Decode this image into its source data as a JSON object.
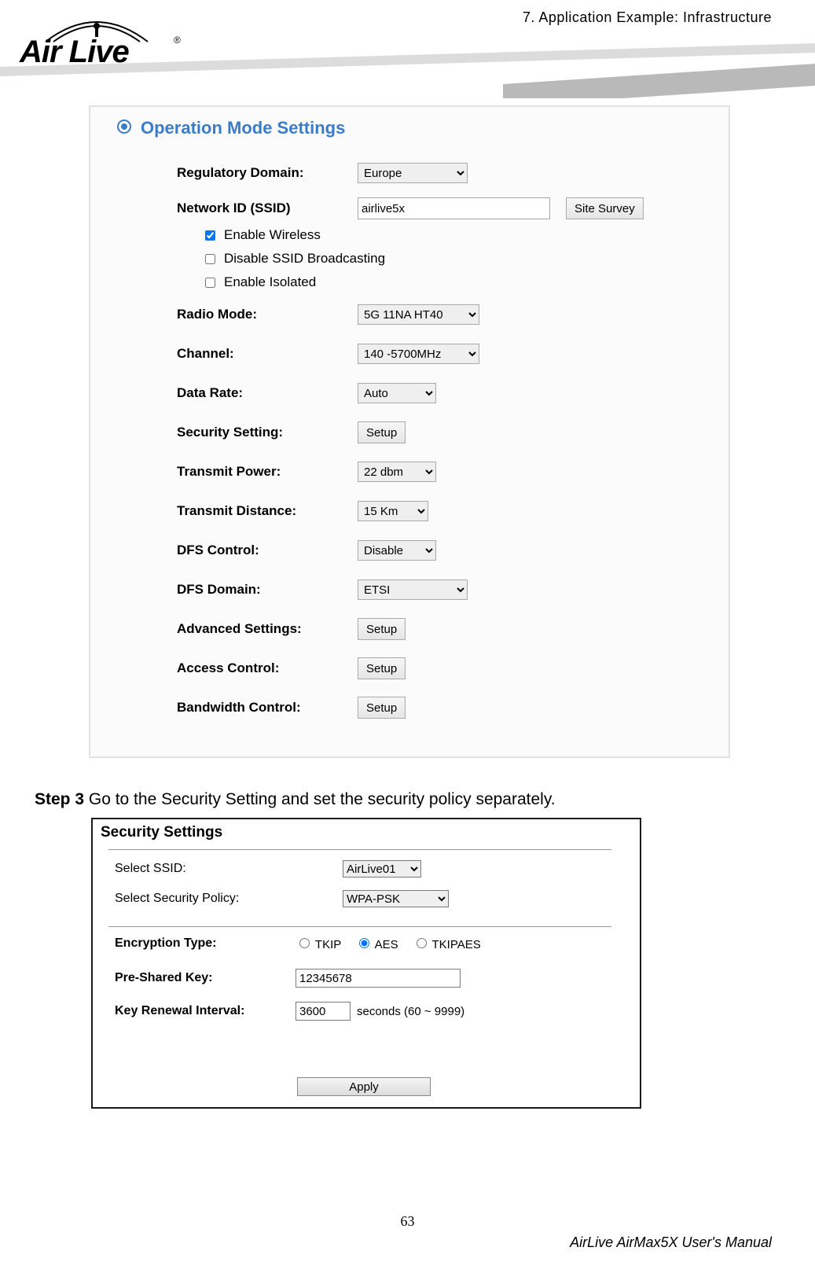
{
  "header": {
    "section": "7. Application Example: Infrastructure",
    "logo_text": "Air Live",
    "logo_tm": "®"
  },
  "panel1": {
    "title": "Operation Mode Settings",
    "rows": {
      "regulatory_label": "Regulatory Domain:",
      "regulatory_value": "Europe",
      "ssid_label": "Network ID (SSID)",
      "ssid_value": "airlive5x",
      "site_survey": "Site Survey",
      "enable_wireless": "Enable Wireless",
      "disable_ssid_broadcast": "Disable SSID Broadcasting",
      "enable_isolated": "Enable Isolated",
      "radio_mode_label": "Radio Mode:",
      "radio_mode_value": "5G 11NA HT40",
      "channel_label": "Channel:",
      "channel_value": "140 -5700MHz",
      "data_rate_label": "Data Rate:",
      "data_rate_value": "Auto",
      "security_label": "Security Setting:",
      "security_btn": "Setup",
      "txpower_label": "Transmit Power:",
      "txpower_value": "22 dbm",
      "txdist_label": "Transmit Distance:",
      "txdist_value": "15 Km",
      "dfs_ctrl_label": "DFS Control:",
      "dfs_ctrl_value": "Disable",
      "dfs_domain_label": "DFS Domain:",
      "dfs_domain_value": "ETSI",
      "adv_label": "Advanced Settings:",
      "adv_btn": "Setup",
      "access_label": "Access Control:",
      "access_btn": "Setup",
      "bw_label": "Bandwidth Control:",
      "bw_btn": "Setup"
    }
  },
  "step3": {
    "strong": "Step 3",
    "text": "  Go to the Security Setting and set the security policy separately."
  },
  "panel2": {
    "title": "Security Settings",
    "select_ssid_label": "Select SSID:",
    "select_ssid_value": "AirLive01",
    "select_policy_label": "Select Security Policy:",
    "select_policy_value": "WPA-PSK",
    "enc_label": "Encryption Type:",
    "enc_tkip": "TKIP",
    "enc_aes": "AES",
    "enc_tkipaes": "TKIPAES",
    "psk_label": "Pre-Shared Key:",
    "psk_value": "12345678",
    "kri_label": "Key Renewal Interval:",
    "kri_value": "3600",
    "kri_unit": "seconds   (60 ~ 9999)",
    "apply": "Apply"
  },
  "footer": {
    "page": "63",
    "manual": "AirLive AirMax5X User's Manual"
  }
}
